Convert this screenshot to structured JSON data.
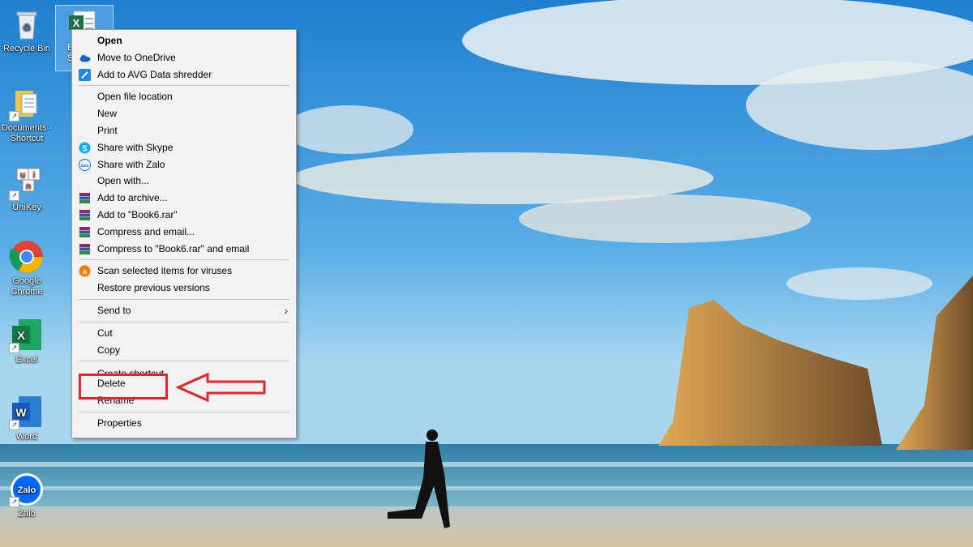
{
  "desktop_icons": [
    {
      "label": "Recycle Bin",
      "icon": "recycle-bin-icon"
    },
    {
      "label": "Documents - Shortcut",
      "icon": "documents-folder-icon"
    },
    {
      "label": "UniKey",
      "icon": "unikey-icon"
    },
    {
      "label": "Google Chrome",
      "icon": "chrome-icon"
    },
    {
      "label": "Excel",
      "icon": "excel-icon"
    },
    {
      "label": "Word",
      "icon": "word-icon"
    },
    {
      "label": "Zalo",
      "icon": "zalo-icon"
    }
  ],
  "selected_file": {
    "label_fragment": "B\nS",
    "icon": "excel-file-icon"
  },
  "context_menu": {
    "open": "Open",
    "move_to_onedrive": "Move to OneDrive",
    "add_to_avg": "Add to AVG Data shredder",
    "open_file_location": "Open file location",
    "new": "New",
    "print": "Print",
    "share_skype": "Share with Skype",
    "share_zalo": "Share with Zalo",
    "open_with": "Open with...",
    "add_to_archive": "Add to archive...",
    "add_to_rar": "Add to \"Book6.rar\"",
    "compress_email": "Compress and email...",
    "compress_rar_email": "Compress to \"Book6.rar\" and email",
    "scan_viruses": "Scan selected items for viruses",
    "restore_versions": "Restore previous versions",
    "send_to": "Send to",
    "cut": "Cut",
    "copy": "Copy",
    "create_shortcut": "Create shortcut",
    "delete": "Delete",
    "rename": "Rename",
    "properties": "Properties"
  },
  "colors": {
    "highlight": "#e0252b",
    "menu_bg": "#f2f2f2"
  },
  "zalo_icon_text": "Zalo"
}
